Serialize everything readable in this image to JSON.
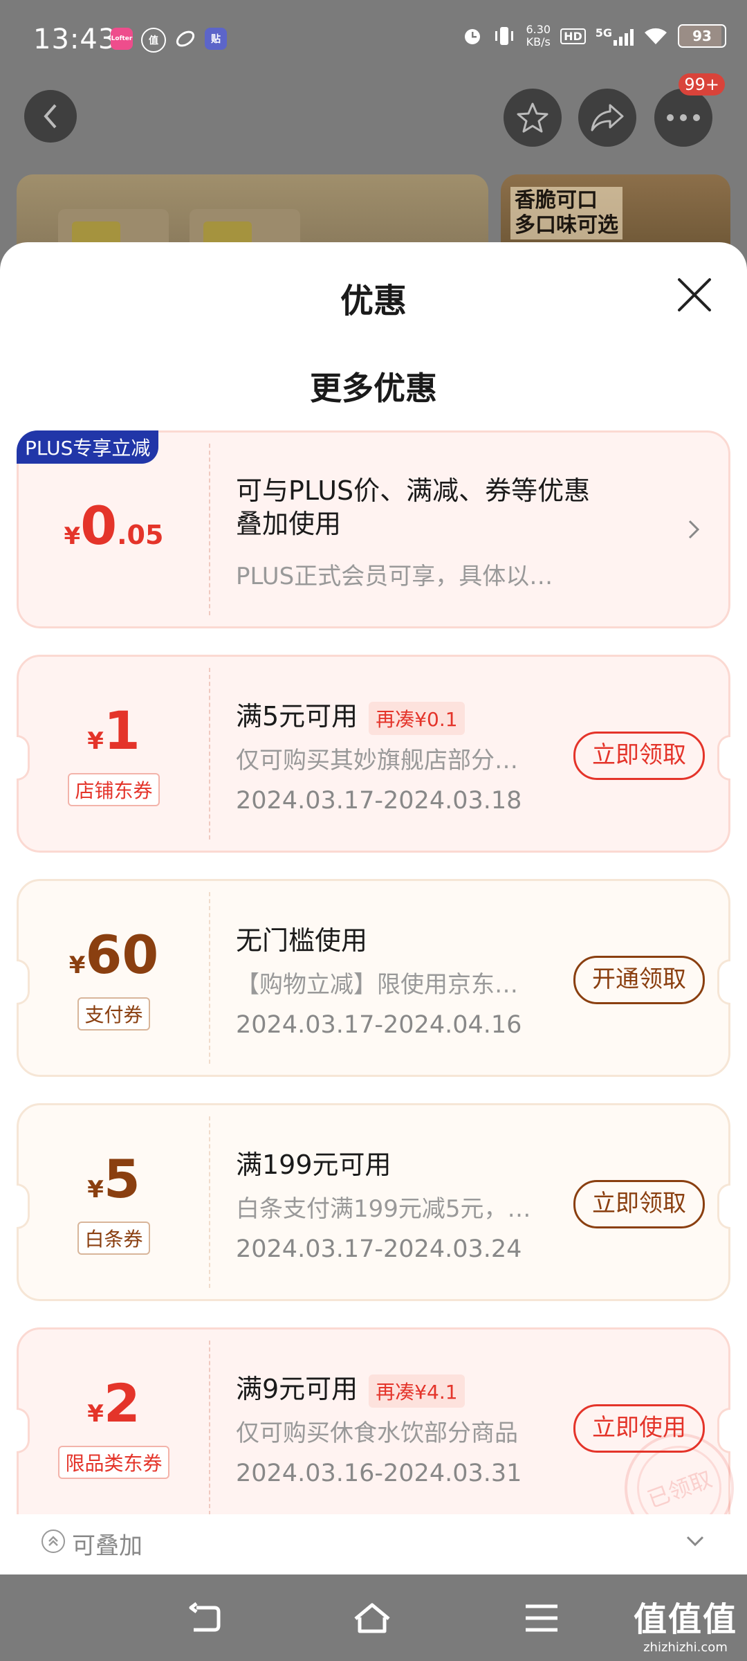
{
  "status_bar": {
    "time": "13:43",
    "app_icons": [
      {
        "icon": "lofter-icon",
        "label": "Lofter",
        "color": "#ee4d8c"
      },
      {
        "icon": "zhi-icon",
        "label": "值",
        "color": "#8a8a8a"
      },
      {
        "icon": "leaf-icon",
        "label": "",
        "color": "#8a8a8a"
      },
      {
        "icon": "tie-icon",
        "label": "贴",
        "color": "#5c65c9"
      }
    ],
    "speed_value": "6.30",
    "speed_unit": "KB/s",
    "hd_label": "HD",
    "network": "5G",
    "battery_level": "93",
    "battery_fraction": 0.93
  },
  "header": {
    "more_badge": "99+",
    "product_banner_text": "香脆可口\n多口味可选"
  },
  "sheet": {
    "title": "优惠",
    "section_title": "更多优惠"
  },
  "plus_card": {
    "badge": "PLUS专享立减",
    "currency": "¥",
    "amount_int": "0",
    "amount_dec": ".05",
    "title": "可与PLUS价、满减、券等优惠叠加使用",
    "desc": "PLUS正式会员可享，具体以…"
  },
  "coupons": [
    {
      "currency": "¥",
      "amount": "1",
      "tag": "店铺东券",
      "condition": "满5元可用",
      "extra": "再凑¥0.1",
      "desc": "仅可购买其妙旗舰店部分…",
      "date": "2024.03.17-2024.03.18",
      "action": "立即领取"
    },
    {
      "currency": "¥",
      "amount": "60",
      "tag": "支付券",
      "condition": "无门槛使用",
      "extra": "",
      "desc": "【购物立减】限使用京东…",
      "date": "2024.03.17-2024.04.16",
      "action": "开通领取"
    },
    {
      "currency": "¥",
      "amount": "5",
      "tag": "白条券",
      "condition": "满199元可用",
      "extra": "",
      "desc": "白条支付满199元减5元，…",
      "date": "2024.03.17-2024.03.24",
      "action": "立即领取"
    },
    {
      "currency": "¥",
      "amount": "2",
      "tag": "限品类东券",
      "condition": "满9元可用",
      "extra": "再凑¥4.1",
      "desc": "仅可购买休食水饮部分商品",
      "date": "2024.03.16-2024.03.31",
      "action": "立即使用",
      "stamp": "已领取"
    }
  ],
  "stack_row": {
    "label": "可叠加"
  },
  "colors": {
    "red": "#e4342a",
    "brown": "#8a3f10",
    "plus_blue": "#2136a8"
  },
  "watermark": {
    "big": "值值值",
    "small": "zhizhizhi.com"
  }
}
